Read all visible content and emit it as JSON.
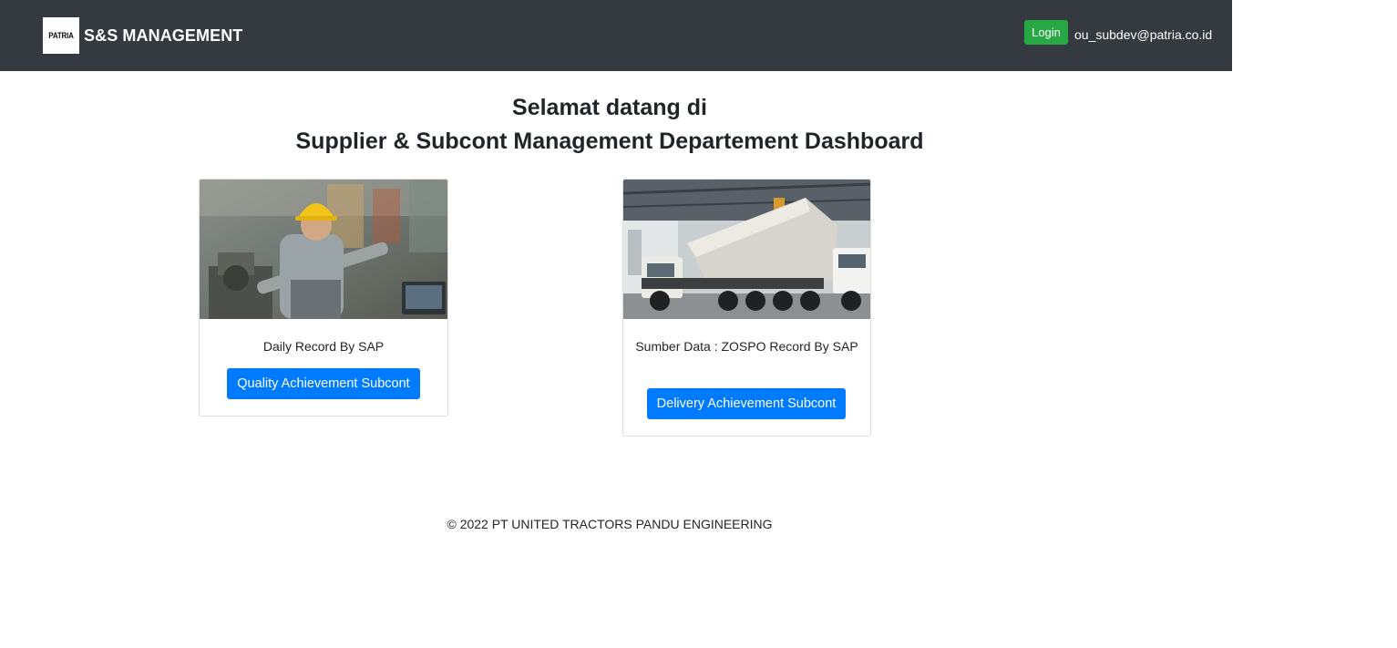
{
  "navbar": {
    "logo_text": "PATRIA",
    "brand": "S&S MANAGEMENT",
    "login_label": "Login",
    "user_email": "ou_subdev@patria.co.id",
    "background": "#343a40"
  },
  "welcome": {
    "line1": "Selamat datang di",
    "line2": "Supplier & Subcont Management Departement Dashboard"
  },
  "cards": [
    {
      "image": "worker-photo",
      "text": "Daily Record By SAP",
      "button_label": "Quality Achievement Subcont"
    },
    {
      "image": "dump-truck-photo",
      "text": "Sumber Data : ZOSPO Record By SAP",
      "button_label": "Delivery Achievement Subcont"
    }
  ],
  "footer": {
    "copyright": "© 2022 PT UNITED TRACTORS PANDU ENGINEERING"
  },
  "colors": {
    "navbar": "#343a40",
    "login_button": "#28a745",
    "primary_button": "#007bff"
  }
}
